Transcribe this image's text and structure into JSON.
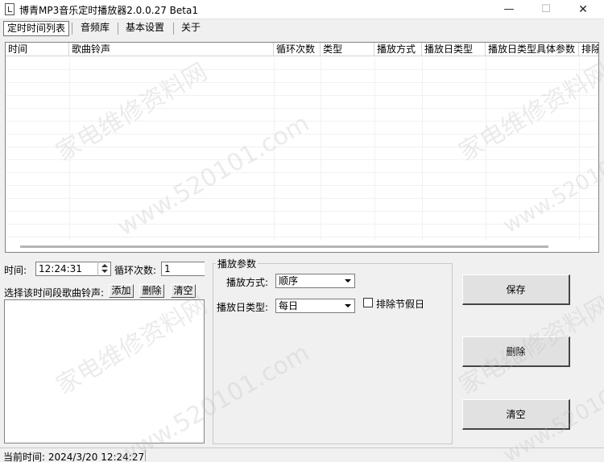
{
  "window": {
    "title": "博青MP3音乐定时播放器2.0.0.27 Beta1",
    "minimize": "—",
    "maximize": "☐",
    "close": "✕"
  },
  "tabs": [
    "定时时间列表",
    "音频库",
    "基本设置",
    "关于"
  ],
  "table": {
    "columns": [
      "时间",
      "歌曲铃声",
      "循环次数",
      "类型",
      "播放方式",
      "播放日类型",
      "播放日类型具体参数",
      "排除"
    ],
    "rows": []
  },
  "form": {
    "time_label": "时间:",
    "time_value": "12:24:31",
    "loop_label": "循环次数:",
    "loop_value": "1",
    "select_song_label": "选择该时间段歌曲铃声:",
    "add_label": "添加",
    "delete_label": "删除",
    "clear_label": "清空"
  },
  "params": {
    "group_title": "播放参数",
    "mode_label": "播放方式:",
    "mode_value": "顺序",
    "day_type_label": "播放日类型:",
    "day_type_value": "每日",
    "exclude_holiday_label": "排除节假日"
  },
  "actions": {
    "save": "保存",
    "delete": "删除",
    "clear": "清空"
  },
  "status": {
    "current_time": "当前时间: 2024/3/20 12:24:27"
  },
  "watermark": {
    "site": "www.520101.com",
    "name": "家电维修资料网"
  },
  "icons": {
    "app": "music-file-icon",
    "spinner": "spin-up-down-icon",
    "dropdown": "chevron-down-icon"
  }
}
